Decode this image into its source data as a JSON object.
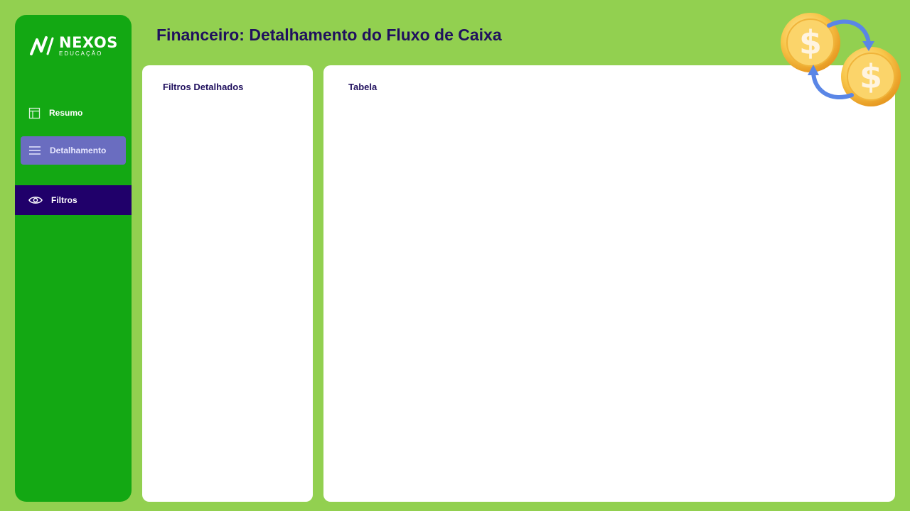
{
  "app": {
    "brand_name": "NEXOS",
    "brand_sub": "EDUCAÇÃO",
    "page_title": "Financeiro: Detalhamento do Fluxo de Caixa"
  },
  "sidebar": {
    "items": [
      {
        "label": "Resumo",
        "icon": "layout-icon",
        "active": false
      },
      {
        "label": "Detalhamento",
        "icon": "menu-icon",
        "active": true
      },
      {
        "label": "Filtros",
        "icon": "eye-icon",
        "active": false
      }
    ]
  },
  "panels": {
    "filters_title": "Filtros Detalhados",
    "table_title": "Tabela"
  },
  "colors": {
    "background": "#92d050",
    "sidebar": "#13a813",
    "active_item": "#6a6dc0",
    "filters_item": "#20006a",
    "title_text": "#20105e"
  },
  "decoration": {
    "icon": "coins-exchange-icon"
  }
}
